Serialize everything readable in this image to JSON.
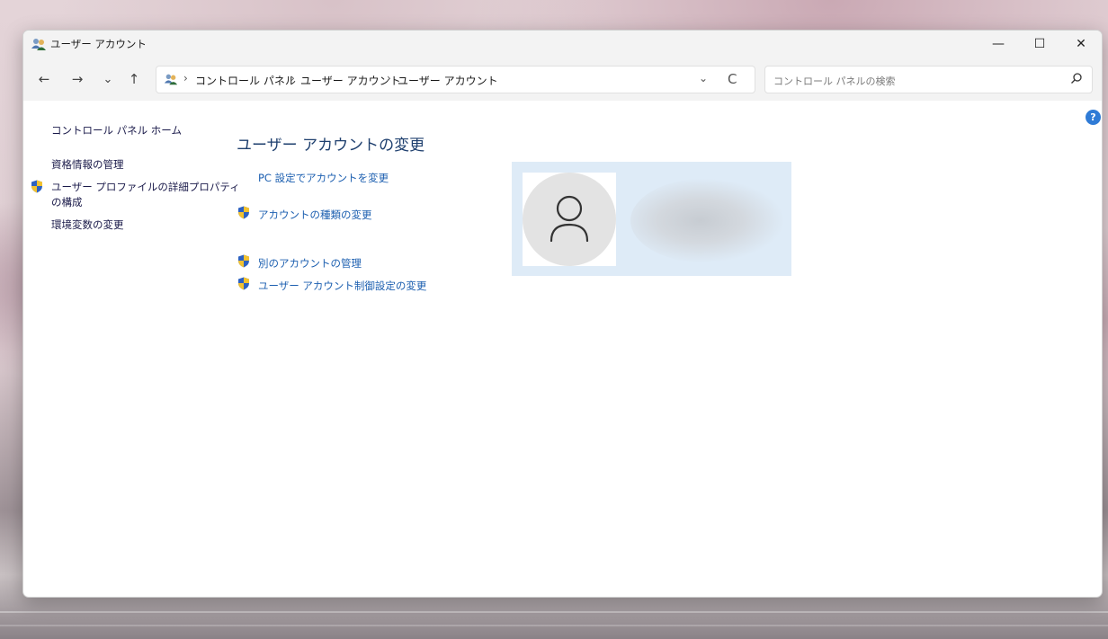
{
  "window": {
    "title": "ユーザー アカウント",
    "controls": {
      "minimize": "—",
      "maximize": "☐",
      "close": "✕"
    }
  },
  "navbar": {
    "back_icon": "←",
    "forward_icon": "→",
    "recent_icon": "⌄",
    "up_icon": "↑",
    "breadcrumbs": [
      "コントロール パネル",
      "ユーザー アカウント",
      "ユーザー アカウント"
    ],
    "separator": "›",
    "dropdown_icon": "⌄",
    "refresh_icon": "C",
    "search_placeholder": "コントロール パネルの検索"
  },
  "sidebar": {
    "items": [
      {
        "label": "コントロール パネル ホーム",
        "shield": false
      },
      {
        "label": "資格情報の管理",
        "shield": false
      },
      {
        "label": "ユーザー プロファイルの詳細プロパティ",
        "label2": "の構成",
        "shield": true
      },
      {
        "label": "環境変数の変更",
        "shield": false
      }
    ]
  },
  "main": {
    "title": "ユーザー アカウントの変更",
    "tasks": [
      {
        "label": "PC 設定でアカウントを変更",
        "shield": false
      },
      {
        "label": "アカウントの種類の変更",
        "shield": true
      },
      {
        "label": "別のアカウントの管理",
        "shield": true
      },
      {
        "label": "ユーザー アカウント制御設定の変更",
        "shield": true
      }
    ]
  },
  "help": {
    "label": "?"
  },
  "colors": {
    "link": "#1c5fb0",
    "title": "#1e3f6e",
    "tile_bg": "#deebf7",
    "accent": "#2f7bd6"
  }
}
